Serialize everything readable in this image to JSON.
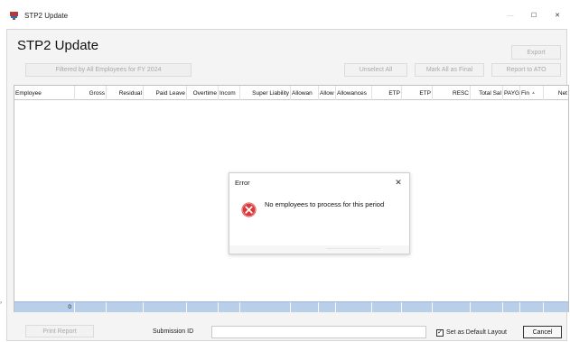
{
  "window": {
    "title": "STP2 Update",
    "icon": "stp-app-icon",
    "controls": {
      "minimize": "—",
      "maximize": "☐",
      "close": "✕"
    }
  },
  "page": {
    "title": "STP2 Update"
  },
  "toolbar": {
    "export_label": "Export",
    "filter_label": "Filtered by All Employees for FY 2024",
    "unselect_all_label": "Unselect All",
    "mark_all_final_label": "Mark All as Final",
    "report_to_ato_label": "Report to ATO"
  },
  "grid": {
    "columns": [
      {
        "label": "Employee",
        "align": "left"
      },
      {
        "label": "Gross",
        "align": "right"
      },
      {
        "label": "Residual",
        "align": "right"
      },
      {
        "label": "Paid Leave",
        "align": "right"
      },
      {
        "label": "Overtime",
        "align": "right"
      },
      {
        "label": "Incom",
        "align": "left"
      },
      {
        "label": "Super Liability",
        "align": "right"
      },
      {
        "label": "Allowan",
        "align": "left"
      },
      {
        "label": "Allow",
        "align": "left"
      },
      {
        "label": "Allowances",
        "align": "left"
      },
      {
        "label": "ETP",
        "align": "right"
      },
      {
        "label": "ETP",
        "align": "right"
      },
      {
        "label": "RESC",
        "align": "right"
      },
      {
        "label": "Total Sal",
        "align": "right"
      },
      {
        "label": "PAYG",
        "align": "left"
      },
      {
        "label": "Fin",
        "align": "left"
      },
      {
        "label": "Net",
        "align": "right"
      }
    ],
    "rows": [],
    "footer": {
      "employee_count": "0"
    }
  },
  "dialog": {
    "title": "Error",
    "message": "No employees to process for this period",
    "icon": "error-icon",
    "close_glyph": "✕"
  },
  "bottom": {
    "print_report_label": "Print Report",
    "submission_id_label": "Submission ID",
    "submission_id_value": "",
    "default_layout_label": "Set as Default Layout",
    "default_layout_checked": true,
    "checkbox_glyph": "✓",
    "cancel_label": "Cancel"
  },
  "colors": {
    "footer_band": "#b9cfe9",
    "error_red": "#d8393b",
    "disabled_text": "#a9a9a9"
  }
}
